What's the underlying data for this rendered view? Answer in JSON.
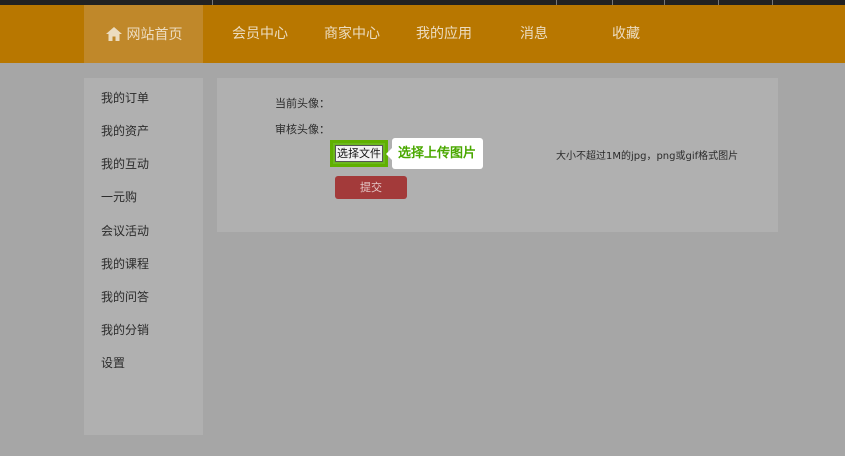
{
  "nav": {
    "home": "网站首页",
    "items": [
      {
        "label": "会员中心"
      },
      {
        "label": "商家中心"
      },
      {
        "label": "我的应用"
      },
      {
        "label": "消息"
      },
      {
        "label": "收藏"
      }
    ]
  },
  "sidebar": {
    "items": [
      {
        "label": "我的订单"
      },
      {
        "label": "我的资产"
      },
      {
        "label": "我的互动"
      },
      {
        "label": "一元购"
      },
      {
        "label": "会议活动"
      },
      {
        "label": "我的课程"
      },
      {
        "label": "我的问答"
      },
      {
        "label": "我的分销"
      },
      {
        "label": "设置"
      }
    ]
  },
  "form": {
    "current_avatar_label": "当前头像：",
    "review_avatar_label": "审核头像：",
    "file_button": "选择文件",
    "tip": "选择上传图片",
    "hint": "大小不超过1M的jpg，png或gif格式图片",
    "submit": "提交"
  },
  "colors": {
    "nav_bg": "#b87700",
    "accent_green": "#5fb000",
    "submit_red": "#a33a3a"
  },
  "icons": {
    "home": "home-icon"
  }
}
